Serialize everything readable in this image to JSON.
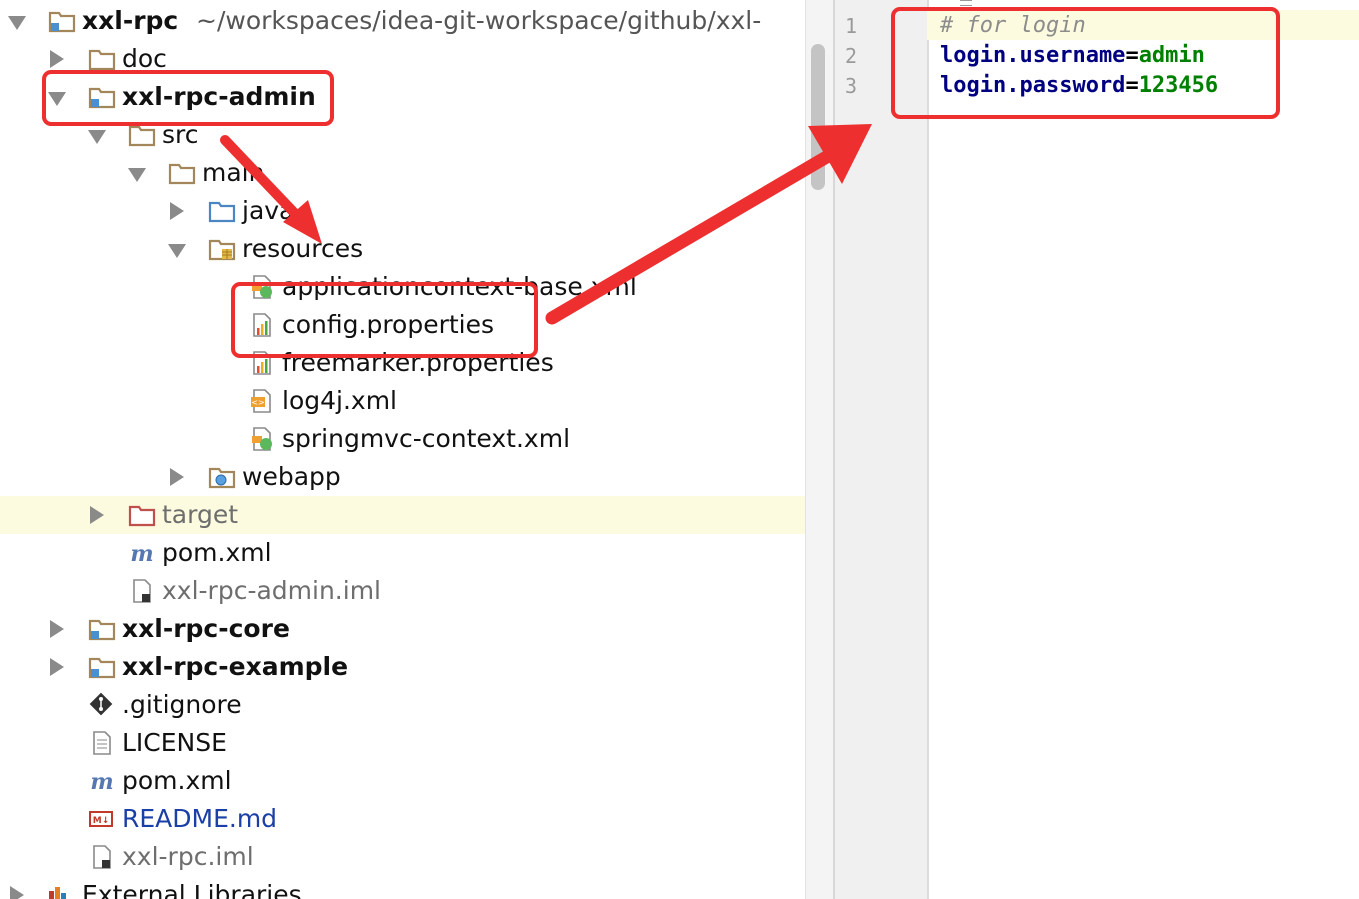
{
  "project": {
    "name": "xxl-rpc",
    "path": "~/workspaces/idea-git-workspace/github/xxl-"
  },
  "tree": [
    {
      "label": "doc"
    },
    {
      "label": "xxl-rpc-admin"
    },
    {
      "label": "src"
    },
    {
      "label": "main"
    },
    {
      "label": "java"
    },
    {
      "label": "resources"
    },
    {
      "label": "applicationcontext-base.xml"
    },
    {
      "label": "config.properties"
    },
    {
      "label": "freemarker.properties"
    },
    {
      "label": "log4j.xml"
    },
    {
      "label": "springmvc-context.xml"
    },
    {
      "label": "webapp"
    },
    {
      "label": "target"
    },
    {
      "label": "pom.xml"
    },
    {
      "label": "xxl-rpc-admin.iml"
    },
    {
      "label": "xxl-rpc-core"
    },
    {
      "label": "xxl-rpc-example"
    },
    {
      "label": ".gitignore"
    },
    {
      "label": "LICENSE"
    },
    {
      "label": "pom.xml"
    },
    {
      "label": "README.md"
    },
    {
      "label": "xxl-rpc.iml"
    },
    {
      "label": "External Libraries"
    }
  ],
  "editor": {
    "line_numbers": [
      "1",
      "2",
      "3"
    ],
    "comment": "# for login",
    "lines": [
      {
        "key": "login.username",
        "eq": "=",
        "value": "admin"
      },
      {
        "key": "login.password",
        "eq": "=",
        "value": "123456"
      }
    ]
  },
  "icons": {
    "folder": "folder-icon",
    "module": "module-folder-icon",
    "source": "source-folder-icon",
    "resources": "resources-folder-icon",
    "web": "web-folder-icon",
    "excluded": "excluded-folder-icon",
    "spring_xml": "spring-xml-icon",
    "properties": "properties-file-icon",
    "xml": "xml-file-icon",
    "maven": "maven-icon",
    "iml": "iml-file-icon",
    "git": "gitignore-icon",
    "text": "text-file-icon",
    "markdown": "markdown-icon",
    "library": "library-icon"
  },
  "colors": {
    "annotation_red": "#ee2f2f",
    "highlight_row": "#fcfadf",
    "key_color": "#000080",
    "value_color": "#008000",
    "comment_color": "#8c8c8c"
  }
}
